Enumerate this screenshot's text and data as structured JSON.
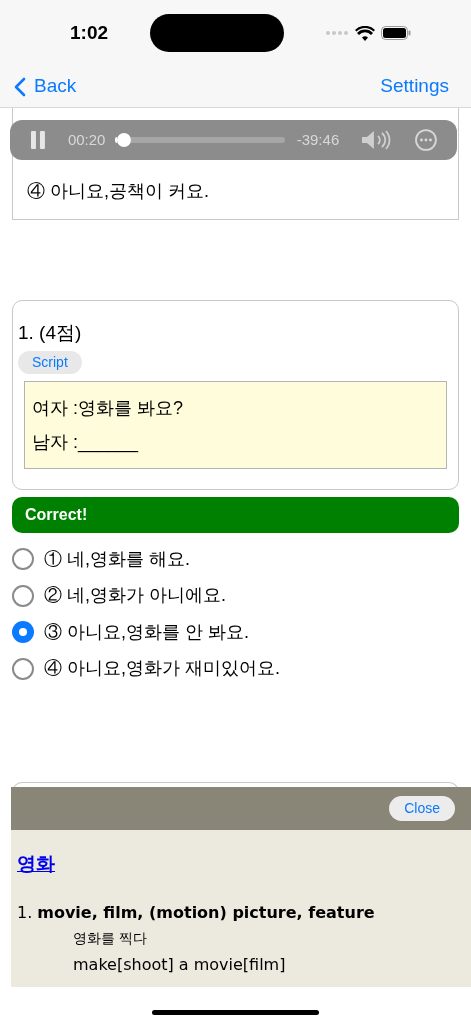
{
  "status_bar": {
    "time": "1:02"
  },
  "nav": {
    "back": "Back",
    "settings": "Settings"
  },
  "previous_question": {
    "options": [
      {
        "marker": "④",
        "text": "아니요,공책이 커요."
      }
    ]
  },
  "player": {
    "playing": true,
    "elapsed": "00:20",
    "remaining": "-39:46",
    "level": 0.01
  },
  "question": {
    "title": "1. (4점)",
    "script_button": "Script",
    "script_lines": [
      "여자 :영화를 봐요?",
      "남자 :______"
    ],
    "result": {
      "kind": "correct",
      "text": "Correct!"
    },
    "options": [
      {
        "marker": "①",
        "text": "네,영화를 해요.",
        "selected": false
      },
      {
        "marker": "②",
        "text": "네,영화가 아니에요.",
        "selected": false
      },
      {
        "marker": "③",
        "text": "아니요,영화를 안 봐요.",
        "selected": true
      },
      {
        "marker": "④",
        "text": "아니요,영화가 재미있어요.",
        "selected": false
      }
    ]
  },
  "dictionary": {
    "close": "Close",
    "word": "영화",
    "senses": [
      {
        "number": "1.",
        "meaning": "movie, film, (motion) picture, feature",
        "examples": [
          "영화를 찍다",
          "make[shoot] a movie[film]"
        ]
      }
    ]
  }
}
